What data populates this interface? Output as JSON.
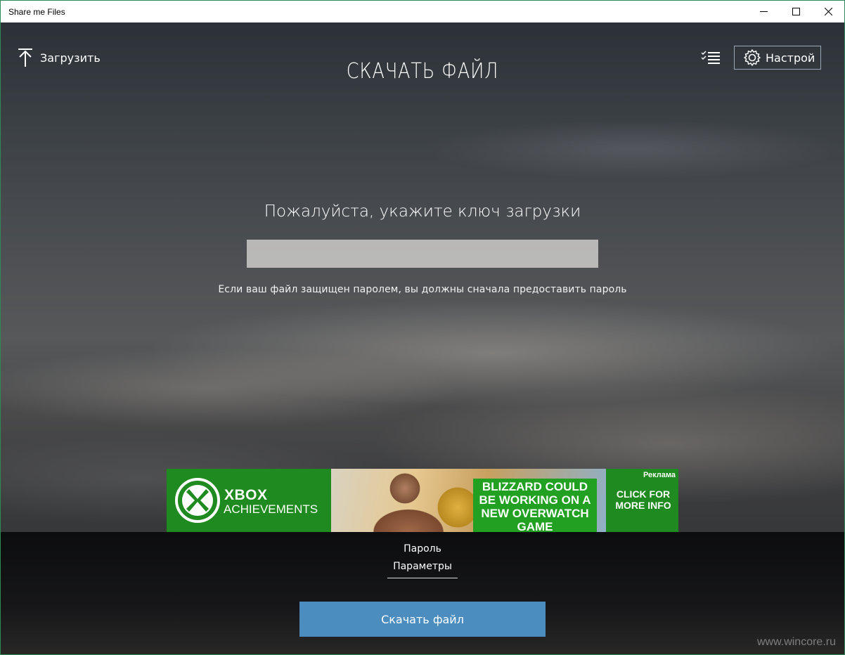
{
  "window": {
    "title": "Share me Files"
  },
  "header": {
    "upload_label": "Загрузить",
    "page_title": "СКАЧАТЬ ФАЙЛ",
    "settings_label": "Настрой",
    "upload_icon": "upload-arrow-icon",
    "list_icon": "checklist-icon",
    "settings_icon": "gear-icon"
  },
  "form": {
    "prompt": "Пожалуйста, укажите ключ загрузки",
    "key_value": "",
    "hint": "Если ваш файл защищен паролем, вы должны сначала предоставить пароль"
  },
  "ad": {
    "brand_line1": "XBOX",
    "brand_line2": "ACHIEVEMENTS",
    "headline": "BLIZZARD COULD BE WORKING ON A NEW OVERWATCH GAME",
    "cta": "CLICK FOR MORE INFO",
    "badge": "Реклама",
    "color": "#1f8a1f"
  },
  "tabs": [
    {
      "label": "Пароль"
    },
    {
      "label": "Параметры"
    }
  ],
  "actions": {
    "download_label": "Скачать файл",
    "accent": "#4c8dc0"
  },
  "watermark": "www.wincore.ru"
}
